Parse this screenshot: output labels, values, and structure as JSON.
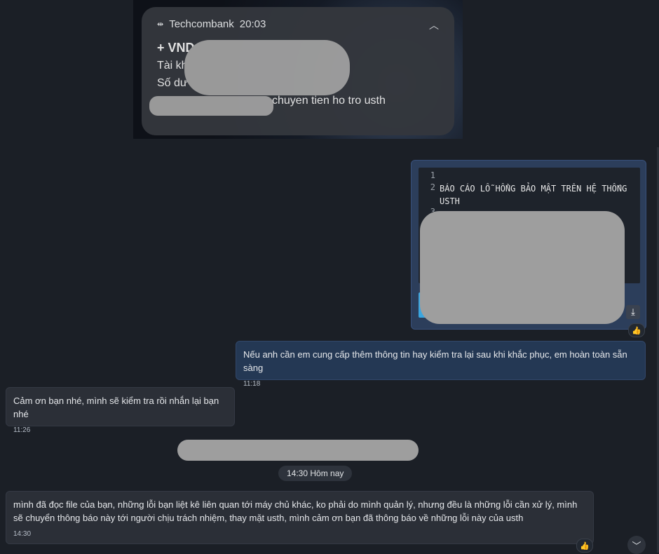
{
  "notification": {
    "app_name": "Techcombank",
    "time": "20:03",
    "amount_prefix": "+ VND",
    "account_prefix": "Tài kh",
    "balance_prefix": "Số dư",
    "description_suffix": "chuyen tien ho tro  usth",
    "app_icon": "transfer-arrows-icon",
    "collapse_icon": "chevron-up-icon"
  },
  "file_message": {
    "line_numbers": [
      "1",
      "2",
      "3"
    ],
    "line2_text": "BÁO CÁO LỖ HỔNG BẢO MẬT TRÊN HỆ THỐNG USTH",
    "download_icon": "download-icon"
  },
  "messages": [
    {
      "direction": "outgoing",
      "text": "Nếu anh cần em cung cấp thêm thông tin hay kiểm tra lại sau khi khắc phục, em hoàn toàn sẵn sàng",
      "time": "11:18"
    },
    {
      "direction": "incoming",
      "text": "Cảm ơn bạn nhé, mình sẽ kiểm tra rồi nhắn lại bạn nhé",
      "time": "11:26"
    },
    {
      "direction": "incoming",
      "text": "mình đã đọc file của bạn, những lỗi bạn liệt kê liên quan tới máy chủ khác, ko phải do mình quản lý, nhưng đều là những lỗi cần xử lý, mình sẽ chuyển thông báo này tới người chịu trách nhiệm, thay mặt usth, mình cảm ơn bạn đã thông báo về những lỗi này của usth",
      "time": "14:30"
    }
  ],
  "date_separator": "14:30 Hôm nay",
  "icons": {
    "react": "thumbs-up-icon",
    "scroll_down": "chevron-down-icon"
  },
  "colors": {
    "background": "#1b1f26",
    "outgoing_bubble": "#243854",
    "incoming_bubble": "#2b2f37",
    "redaction": "#9e9e9e",
    "file_accent": "#3aa6e0"
  }
}
